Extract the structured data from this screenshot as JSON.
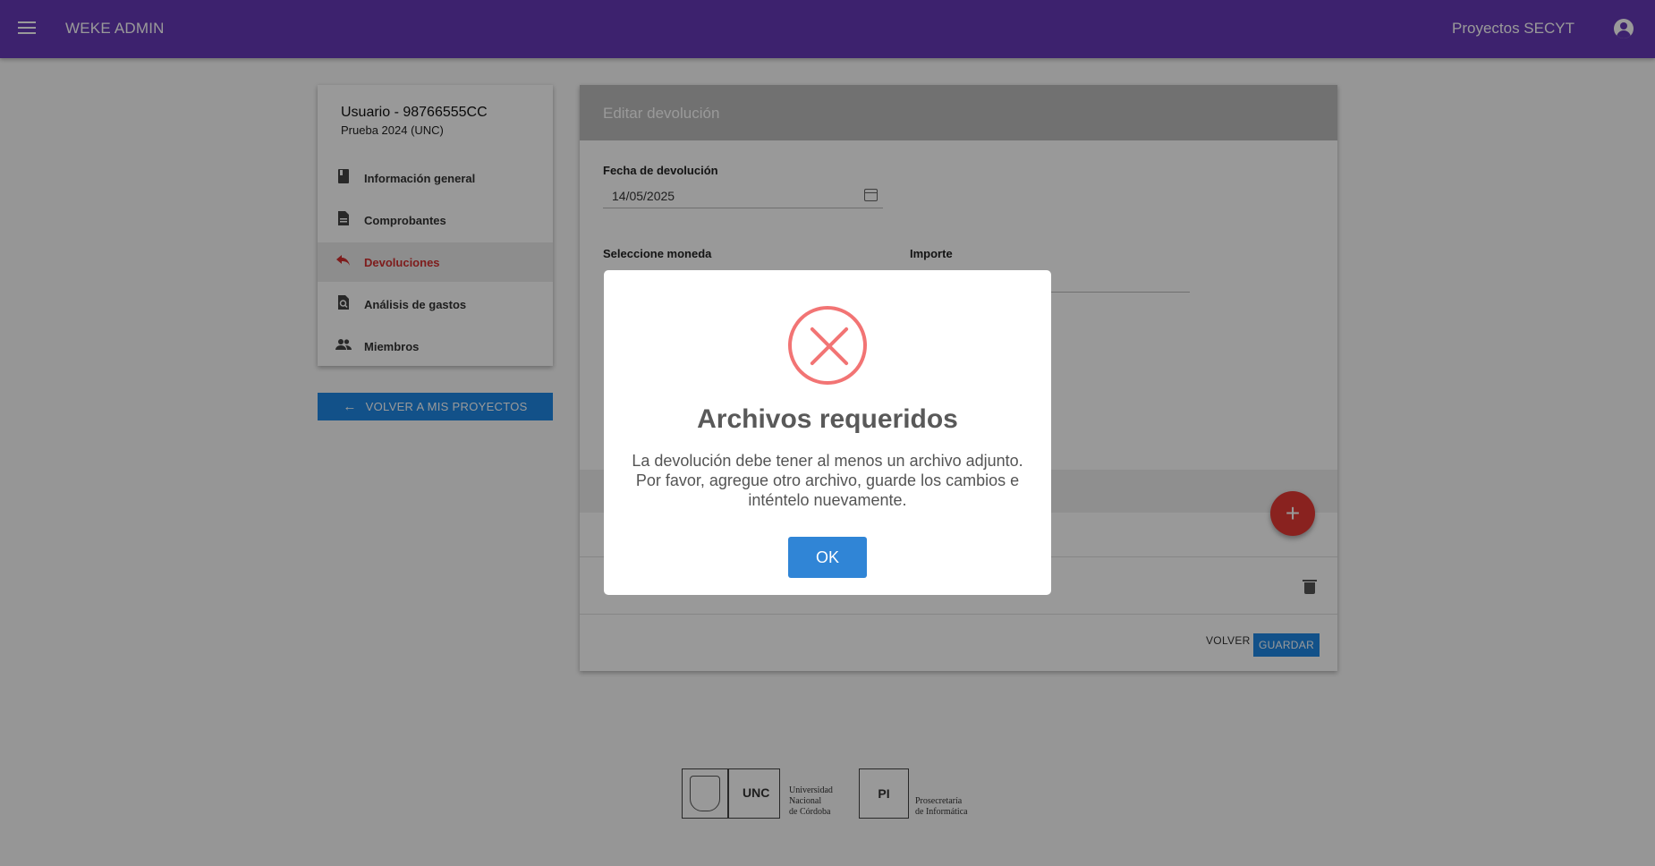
{
  "header": {
    "app_title": "WEKE ADMIN",
    "project_label": "Proyectos SECYT"
  },
  "sidebar": {
    "user_title": "Usuario - 98766555CC",
    "user_subtitle": "Prueba 2024 (UNC)",
    "items": [
      {
        "label": "Información general",
        "icon": "book-icon"
      },
      {
        "label": "Comprobantes",
        "icon": "document-icon"
      },
      {
        "label": "Devoluciones",
        "icon": "reply-icon",
        "active": true
      },
      {
        "label": "Análisis de gastos",
        "icon": "search-document-icon"
      },
      {
        "label": "Miembros",
        "icon": "people-icon"
      }
    ],
    "back_button": "VOLVER A MIS PROYECTOS"
  },
  "main": {
    "title": "Editar devolución",
    "fecha_label": "Fecha de devolución",
    "fecha_value": "14/05/2025",
    "moneda_label": "Seleccione moneda",
    "importe_label": "Importe",
    "volver": "VOLVER",
    "guardar": "GUARDAR"
  },
  "modal": {
    "title": "Archivos requeridos",
    "message": "La devolución debe tener al menos un archivo adjunto. Por favor, agregue otro archivo, guarde los cambios e inténtelo nuevamente.",
    "ok": "OK"
  },
  "footer": {
    "unc_logo_text": "UNC",
    "unc_name_1": "Universidad",
    "unc_name_2": "Nacional",
    "unc_name_3": "de Córdoba",
    "pi_logo_text": "PI",
    "pi_name_1": "Prosecretaría",
    "pi_name_2": "de Informática"
  },
  "colors": {
    "topbar": "#673ab7",
    "primary_button": "#1e88e5",
    "active_item": "#d32f2f",
    "fab": "#e53935",
    "error": "#f27474",
    "modal_ok": "#3085d6"
  }
}
